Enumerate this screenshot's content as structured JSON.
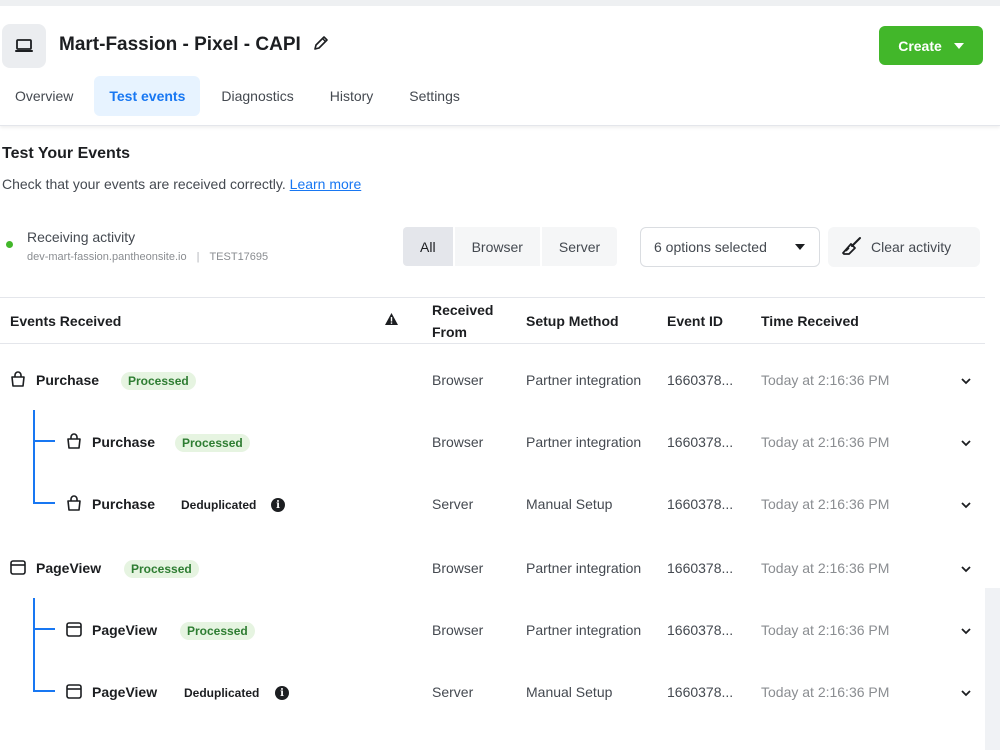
{
  "header": {
    "title": "Mart-Fassion - Pixel - CAPI",
    "create_label": "Create",
    "tabs": [
      {
        "label": "Overview",
        "active": false
      },
      {
        "label": "Test events",
        "active": true
      },
      {
        "label": "Diagnostics",
        "active": false
      },
      {
        "label": "History",
        "active": false
      },
      {
        "label": "Settings",
        "active": false
      }
    ]
  },
  "section": {
    "title": "Test Your Events",
    "description": "Check that your events are received correctly.",
    "learn_more": "Learn more"
  },
  "activity": {
    "status": "Receiving activity",
    "site": "dev-mart-fassion.pantheonsite.io",
    "separator": "|",
    "test_code": "TEST17695",
    "filters": [
      "All",
      "Browser",
      "Server"
    ],
    "options_selected": "6 options selected",
    "clear_label": "Clear activity"
  },
  "table": {
    "headers": {
      "events_received": "Events Received",
      "received_from_1": "Received",
      "received_from_2": "From",
      "setup_method": "Setup Method",
      "event_id": "Event ID",
      "time_received": "Time Received"
    },
    "rows": [
      {
        "icon": "shopping-bag-icon",
        "level": 0,
        "name": "Purchase",
        "badge": "Processed",
        "badge_type": "processed",
        "from": "Browser",
        "setup": "Partner integration",
        "event_id": "1660378...",
        "time": "Today at 2:16:36 PM"
      },
      {
        "icon": "shopping-bag-icon",
        "level": 1,
        "name": "Purchase",
        "badge": "Processed",
        "badge_type": "processed",
        "from": "Browser",
        "setup": "Partner integration",
        "event_id": "1660378...",
        "time": "Today at 2:16:36 PM"
      },
      {
        "icon": "shopping-bag-icon",
        "level": 1,
        "name": "Purchase",
        "badge": "Deduplicated",
        "badge_type": "dedup",
        "from": "Server",
        "setup": "Manual Setup",
        "event_id": "1660378...",
        "time": "Today at 2:16:36 PM"
      },
      {
        "icon": "browser-window-icon",
        "level": 0,
        "name": "PageView",
        "badge": "Processed",
        "badge_type": "processed",
        "from": "Browser",
        "setup": "Partner integration",
        "event_id": "1660378...",
        "time": "Today at 2:16:36 PM"
      },
      {
        "icon": "browser-window-icon",
        "level": 1,
        "name": "PageView",
        "badge": "Processed",
        "badge_type": "processed",
        "from": "Browser",
        "setup": "Partner integration",
        "event_id": "1660378...",
        "time": "Today at 2:16:36 PM"
      },
      {
        "icon": "browser-window-icon",
        "level": 1,
        "name": "PageView",
        "badge": "Deduplicated",
        "badge_type": "dedup",
        "from": "Server",
        "setup": "Manual Setup",
        "event_id": "1660378...",
        "time": "Today at 2:16:36 PM"
      }
    ]
  },
  "colors": {
    "accent": "#1877f2",
    "create": "#42b72a",
    "processed_bg": "#e6f4e1",
    "processed_fg": "#2e7d32"
  }
}
